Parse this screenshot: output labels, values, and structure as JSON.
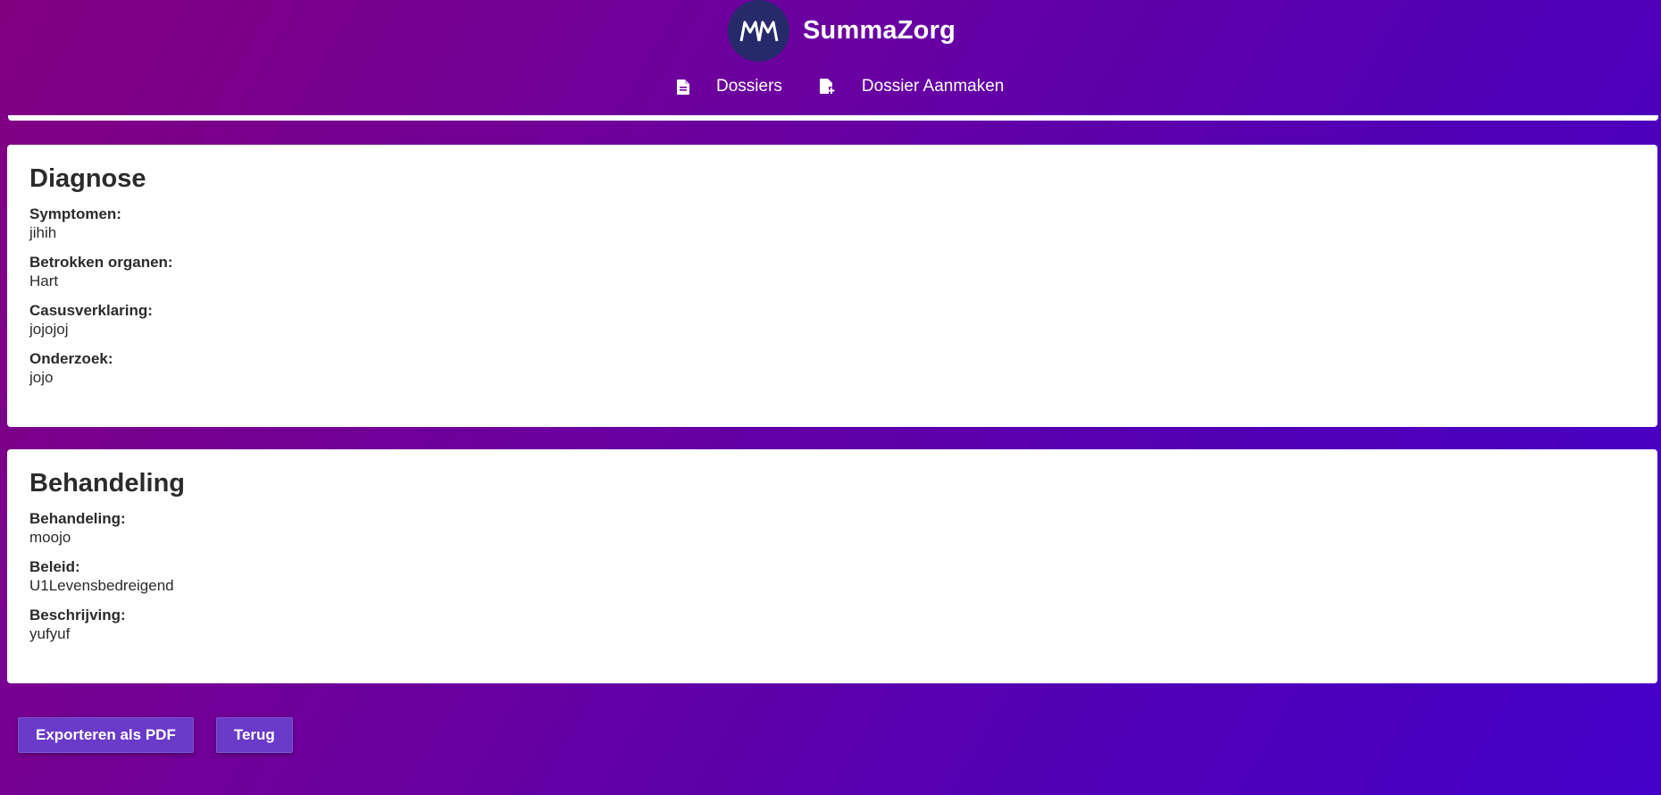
{
  "app": {
    "name": "SummaZorg",
    "logo_text": "MM"
  },
  "nav": {
    "items": [
      {
        "label": "Dossiers",
        "icon": "file-icon"
      },
      {
        "label": "Dossier Aanmaken",
        "icon": "file-add-icon"
      }
    ]
  },
  "diagnose": {
    "title": "Diagnose",
    "fields": [
      {
        "label": "Symptomen:",
        "value": "jihih"
      },
      {
        "label": "Betrokken organen:",
        "value": "Hart"
      },
      {
        "label": "Casusverklaring:",
        "value": "jojojoj"
      },
      {
        "label": "Onderzoek:",
        "value": "jojo"
      }
    ]
  },
  "behandeling": {
    "title": "Behandeling",
    "fields": [
      {
        "label": "Behandeling:",
        "value": "moojo"
      },
      {
        "label": "Beleid:",
        "value": "U1Levensbedreigend"
      },
      {
        "label": "Beschrijving:",
        "value": "yufyuf"
      }
    ]
  },
  "actions": {
    "export_label": "Exporteren als PDF",
    "back_label": "Terug"
  },
  "colors": {
    "accent": "#6a3ac8",
    "logo_bg": "#262a6a",
    "gradient_start": "#820080",
    "gradient_end": "#4400c8"
  }
}
